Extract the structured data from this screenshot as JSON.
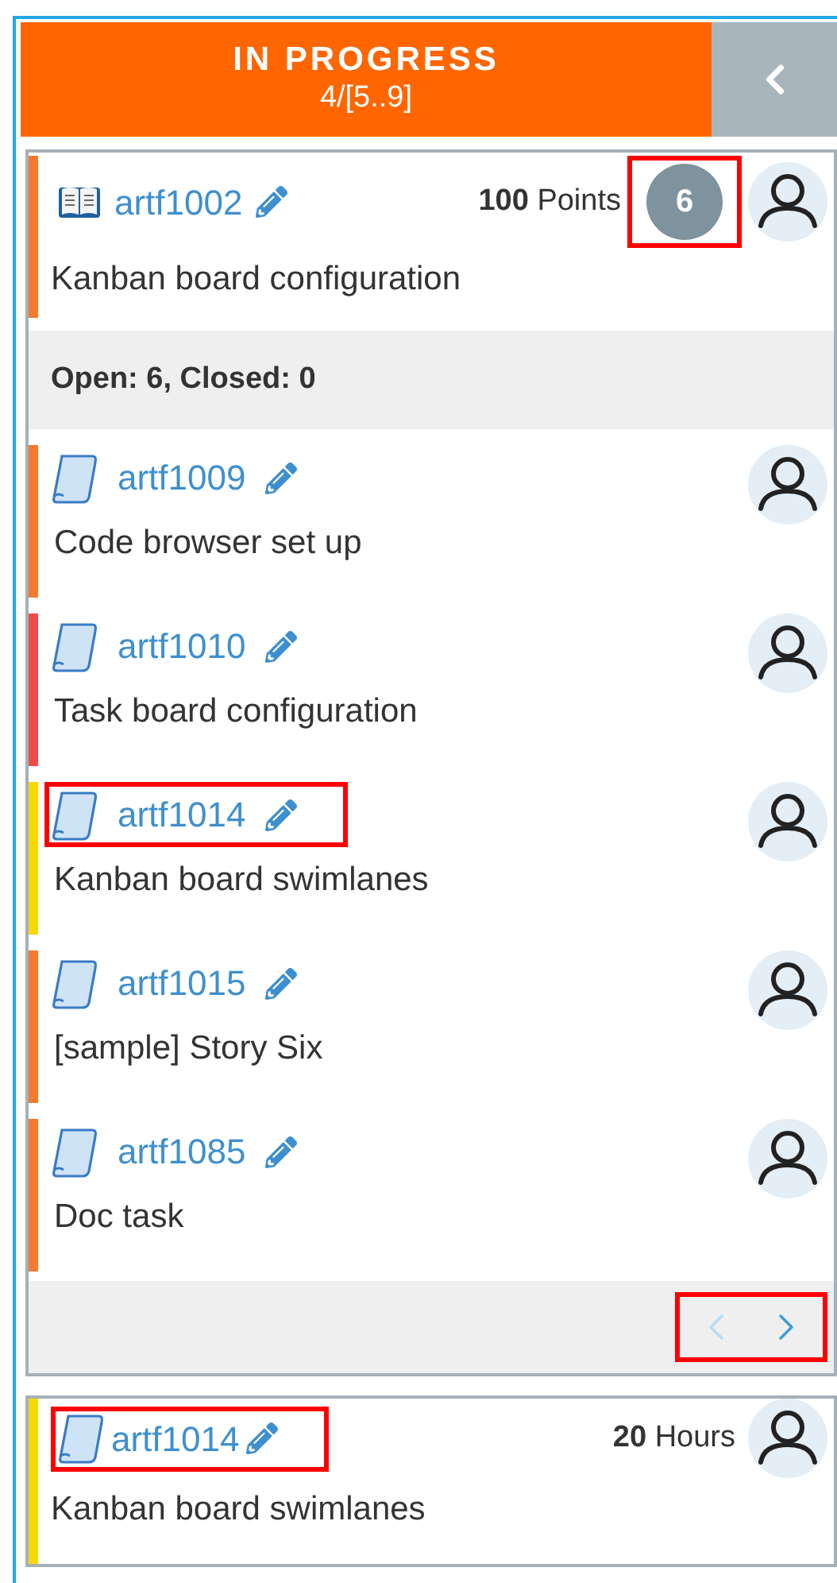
{
  "column": {
    "title": "IN PROGRESS",
    "wip": "4/[5..9]"
  },
  "parent_card": {
    "kind": "epic",
    "id": "artf1002",
    "color": "#f47b2e",
    "estimate_value": "100",
    "estimate_unit": "Points",
    "child_count": "6",
    "child_count_highlighted": true,
    "title": "Kanban board configuration"
  },
  "summary": "Open: 6, Closed: 0",
  "children": [
    {
      "kind": "story",
      "id": "artf1009",
      "color": "#f47b2e",
      "title": "Code browser set up",
      "highlighted": false
    },
    {
      "kind": "story",
      "id": "artf1010",
      "color": "#f04b4b",
      "title": "Task board configuration",
      "highlighted": false
    },
    {
      "kind": "story",
      "id": "artf1014",
      "color": "#f7d900",
      "title": "Kanban board swimlanes",
      "highlighted": true
    },
    {
      "kind": "story",
      "id": "artf1015",
      "color": "#f47b2e",
      "title": "[sample] Story Six",
      "highlighted": false
    },
    {
      "kind": "story",
      "id": "artf1085",
      "color": "#f47b2e",
      "title": "Doc task",
      "highlighted": false
    }
  ],
  "pager": {
    "highlighted": true,
    "prev_disabled": true,
    "next_disabled": false
  },
  "cards": [
    {
      "kind": "story",
      "id": "artf1014",
      "color": "#f7d900",
      "estimate_value": "20",
      "estimate_unit": "Hours",
      "title": "Kanban board swimlanes",
      "highlighted": true
    }
  ]
}
